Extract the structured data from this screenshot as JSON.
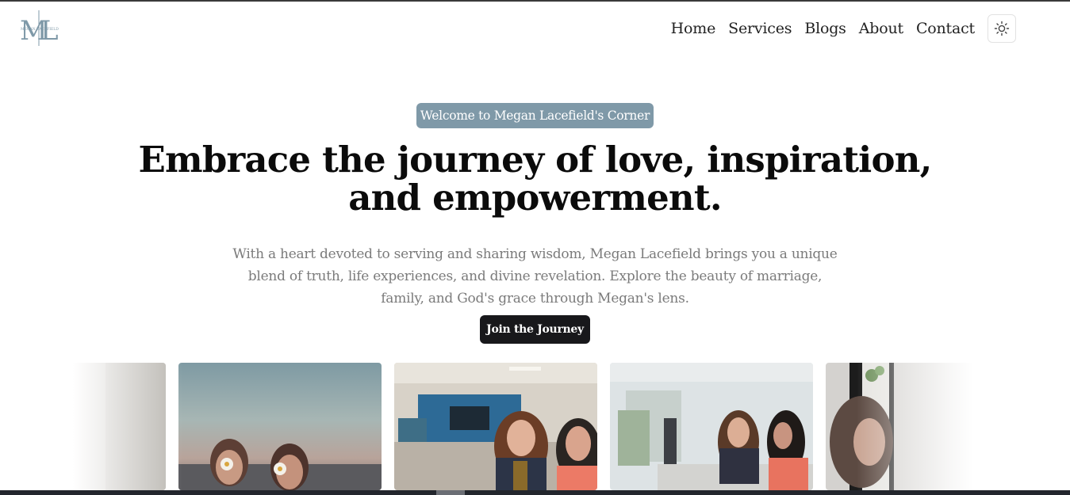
{
  "brand": {
    "logo_letters": "ML",
    "logo_caption": "MEGAN LACEFIELD",
    "logo_color": "#7f99a8"
  },
  "nav": {
    "items": [
      {
        "label": "Home"
      },
      {
        "label": "Services"
      },
      {
        "label": "Blogs"
      },
      {
        "label": "About"
      },
      {
        "label": "Contact"
      }
    ],
    "theme_toggle_icon": "sun-icon"
  },
  "hero": {
    "badge": "Welcome to Megan Lacefield's Corner",
    "headline_line1": "Embrace the journey of love, inspiration,",
    "headline_line2": "and empowerment.",
    "subtext_line1": "With a heart devoted to serving and sharing wisdom, Megan Lacefield brings you a unique",
    "subtext_line2": "blend of truth, life experiences, and divine revelation. Explore the beauty of marriage,",
    "subtext_line3": "family, and God's grace through Megan's lens.",
    "cta_label": "Join the Journey",
    "badge_color": "#7f99a8",
    "cta_color": "#18181b"
  },
  "carousel": {
    "images": [
      {
        "name": "women-with-daisies-photo"
      },
      {
        "name": "office-meeting-photo"
      },
      {
        "name": "glass-office-meeting-photo"
      },
      {
        "name": "woman-by-window-photo"
      }
    ]
  }
}
